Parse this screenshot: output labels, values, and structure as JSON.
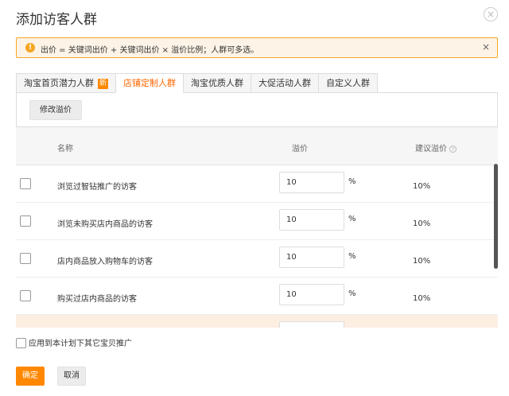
{
  "dialog": {
    "title": "添加访客人群",
    "close_icon": "×"
  },
  "alert": {
    "icon": "!",
    "text": "出价 = 关键词出价 + 关键词出价 × 溢价比例；人群可多选。",
    "close": "×",
    "accent": "#f5a623"
  },
  "tabs": [
    {
      "label": "淘宝首页潜力人群",
      "badge": "新",
      "active": false
    },
    {
      "label": "店铺定制人群",
      "active": true
    },
    {
      "label": "淘宝优质人群",
      "active": false
    },
    {
      "label": "大促活动人群",
      "active": false
    },
    {
      "label": "自定义人群",
      "active": false
    }
  ],
  "toolbar": {
    "modify_label": "修改溢价"
  },
  "table": {
    "headers": {
      "name": "名称",
      "premium": "溢价",
      "suggest": "建议溢价"
    },
    "rows": [
      {
        "name": "浏览过智钻推广的访客",
        "value": "10",
        "unit": "%",
        "suggest": "10%"
      },
      {
        "name": "浏览未购买店内商品的访客",
        "value": "10",
        "unit": "%",
        "suggest": "10%"
      },
      {
        "name": "店内商品放入购物车的访客",
        "value": "10",
        "unit": "%",
        "suggest": "10%"
      },
      {
        "name": "购买过店内商品的访客",
        "value": "10",
        "unit": "%",
        "suggest": "10%"
      }
    ]
  },
  "footer": {
    "apply_all_label": "应用到本计划下其它宝贝推广",
    "ok_label": "确定",
    "cancel_label": "取消",
    "brand_color": "#ff8800"
  }
}
